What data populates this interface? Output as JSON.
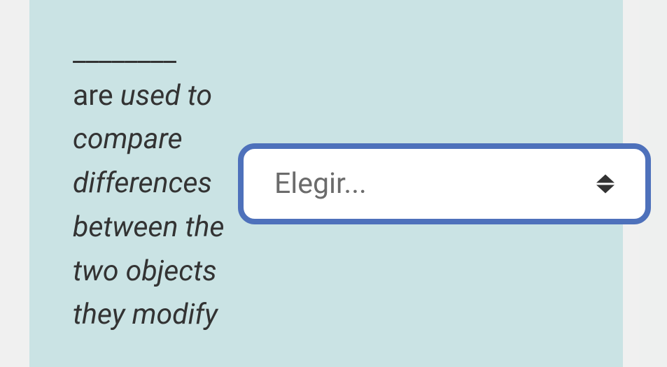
{
  "question": {
    "blank": "________",
    "lead_roman": " are ",
    "italic_text": "used to compare differences between the two objects they modify"
  },
  "select": {
    "placeholder": "Elegir..."
  }
}
